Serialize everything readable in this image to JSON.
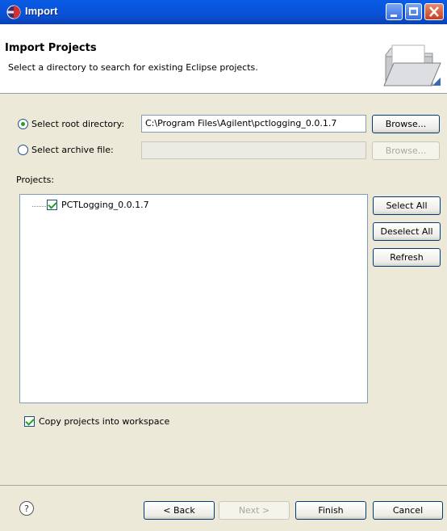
{
  "window": {
    "title": "Import",
    "icon": "eclipse-icon"
  },
  "header": {
    "title": "Import Projects",
    "description": "Select a directory to search for existing Eclipse projects."
  },
  "source": {
    "root_dir_label": "Select root directory:",
    "root_dir_value": "C:\\Program Files\\Agilent\\pctlogging_0.0.1.7",
    "root_dir_browse": "Browse...",
    "archive_label": "Select archive file:",
    "archive_value": "",
    "archive_browse": "Browse...",
    "selected": "root_directory"
  },
  "projects": {
    "label": "Projects:",
    "items": [
      {
        "name": "PCTLogging_0.0.1.7",
        "checked": true
      }
    ],
    "select_all": "Select All",
    "deselect_all": "Deselect All",
    "refresh": "Refresh"
  },
  "options": {
    "copy_label": "Copy projects into workspace",
    "copy_checked": true
  },
  "footer": {
    "back": "< Back",
    "next": "Next >",
    "finish": "Finish",
    "cancel": "Cancel",
    "help_icon": "help-icon"
  }
}
